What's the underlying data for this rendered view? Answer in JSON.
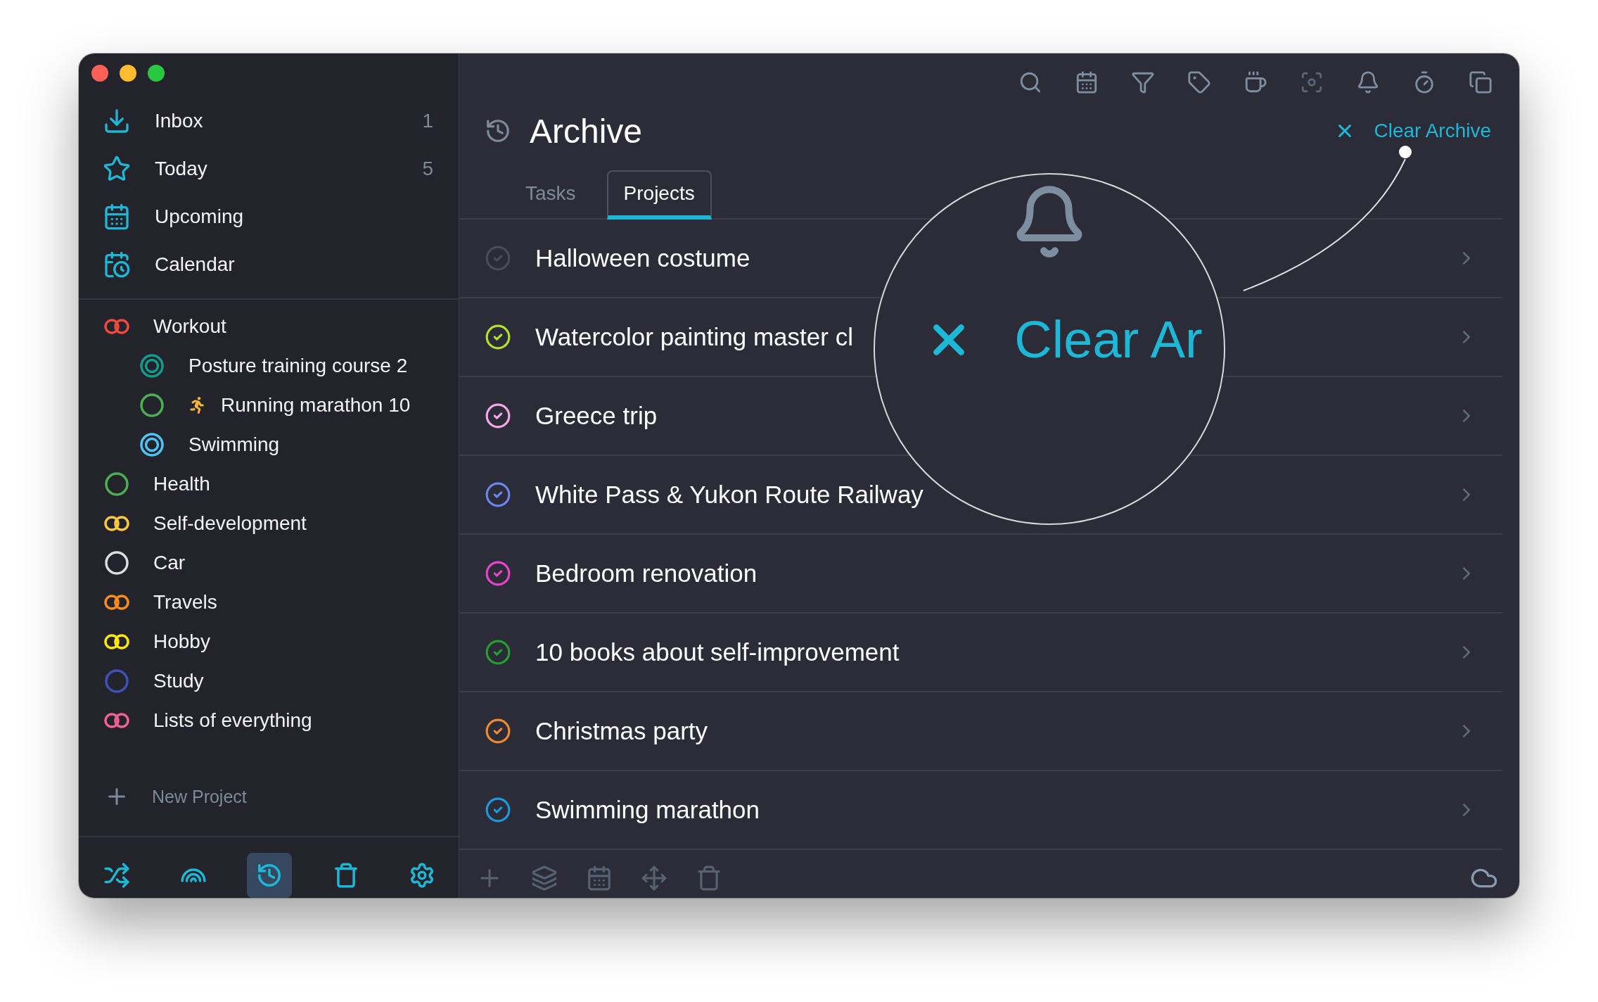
{
  "window": {
    "controls": [
      {
        "kind": "close"
      },
      {
        "kind": "minimize"
      },
      {
        "kind": "zoom"
      }
    ]
  },
  "sidebar": {
    "nav": [
      {
        "label": "Inbox",
        "count": "1"
      },
      {
        "label": "Today",
        "count": "5"
      },
      {
        "label": "Upcoming"
      },
      {
        "label": "Calendar"
      }
    ],
    "projects": [
      {
        "name": "Workout",
        "kind": "group",
        "color": "#f04a3c",
        "children": [
          {
            "name": "Posture training course 2",
            "kind": "target",
            "color": "#129c8c",
            "emoji": false
          },
          {
            "name": "Running marathon 10",
            "kind": "ring",
            "color": "#4caf50",
            "emoji": true
          },
          {
            "name": "Swimming",
            "kind": "target",
            "color": "#4fc3f7",
            "emoji": false
          }
        ]
      },
      {
        "name": "Health",
        "kind": "ring",
        "color": "#4caf50"
      },
      {
        "name": "Self-development",
        "kind": "group",
        "color": "#ffc83d"
      },
      {
        "name": "Car",
        "kind": "ring",
        "color": "#dddddd"
      },
      {
        "name": "Travels",
        "kind": "group",
        "color": "#ff8c1a"
      },
      {
        "name": "Hobby",
        "kind": "group",
        "color": "#ffea00"
      },
      {
        "name": "Study",
        "kind": "ring",
        "color": "#3f51b5"
      },
      {
        "name": "Lists of everything",
        "kind": "group",
        "color": "#f06292"
      }
    ],
    "new_project": "New Project",
    "tools": [
      {
        "selected": false
      },
      {
        "selected": false
      },
      {
        "selected": true
      },
      {
        "selected": false
      },
      {
        "selected": false
      }
    ]
  },
  "toolbar": [
    {
      "disabled": false
    },
    {
      "disabled": false
    },
    {
      "disabled": false
    },
    {
      "disabled": false
    },
    {
      "disabled": false
    },
    {
      "disabled": true
    },
    {
      "disabled": false
    },
    {
      "disabled": false
    },
    {
      "disabled": false
    }
  ],
  "header": {
    "title": "Archive",
    "action": "Clear Archive"
  },
  "tabs": [
    {
      "label": "Tasks",
      "selected": false
    },
    {
      "label": "Projects",
      "selected": true
    }
  ],
  "rows": [
    {
      "title": "Halloween costume",
      "color": "#4a4c58"
    },
    {
      "title": "Watercolor painting master cl",
      "color": "#b5e02e"
    },
    {
      "title": "Greece trip",
      "color": "#f5a8e8"
    },
    {
      "title": "White Pass & Yukon Route Railway",
      "color": "#6a86f0"
    },
    {
      "title": "Bedroom renovation",
      "color": "#e845cc"
    },
    {
      "title": "10 books about self-improvement",
      "color": "#23a02e"
    },
    {
      "title": "Christmas party",
      "color": "#f08a30"
    },
    {
      "title": "Swimming marathon",
      "color": "#1a9ae0"
    }
  ],
  "footer": [
    {
      "disabled": true
    },
    {
      "disabled": true
    },
    {
      "disabled": true
    },
    {
      "disabled": true
    },
    {
      "disabled": true
    }
  ],
  "magnifier": {
    "text": "Clear Ar"
  }
}
